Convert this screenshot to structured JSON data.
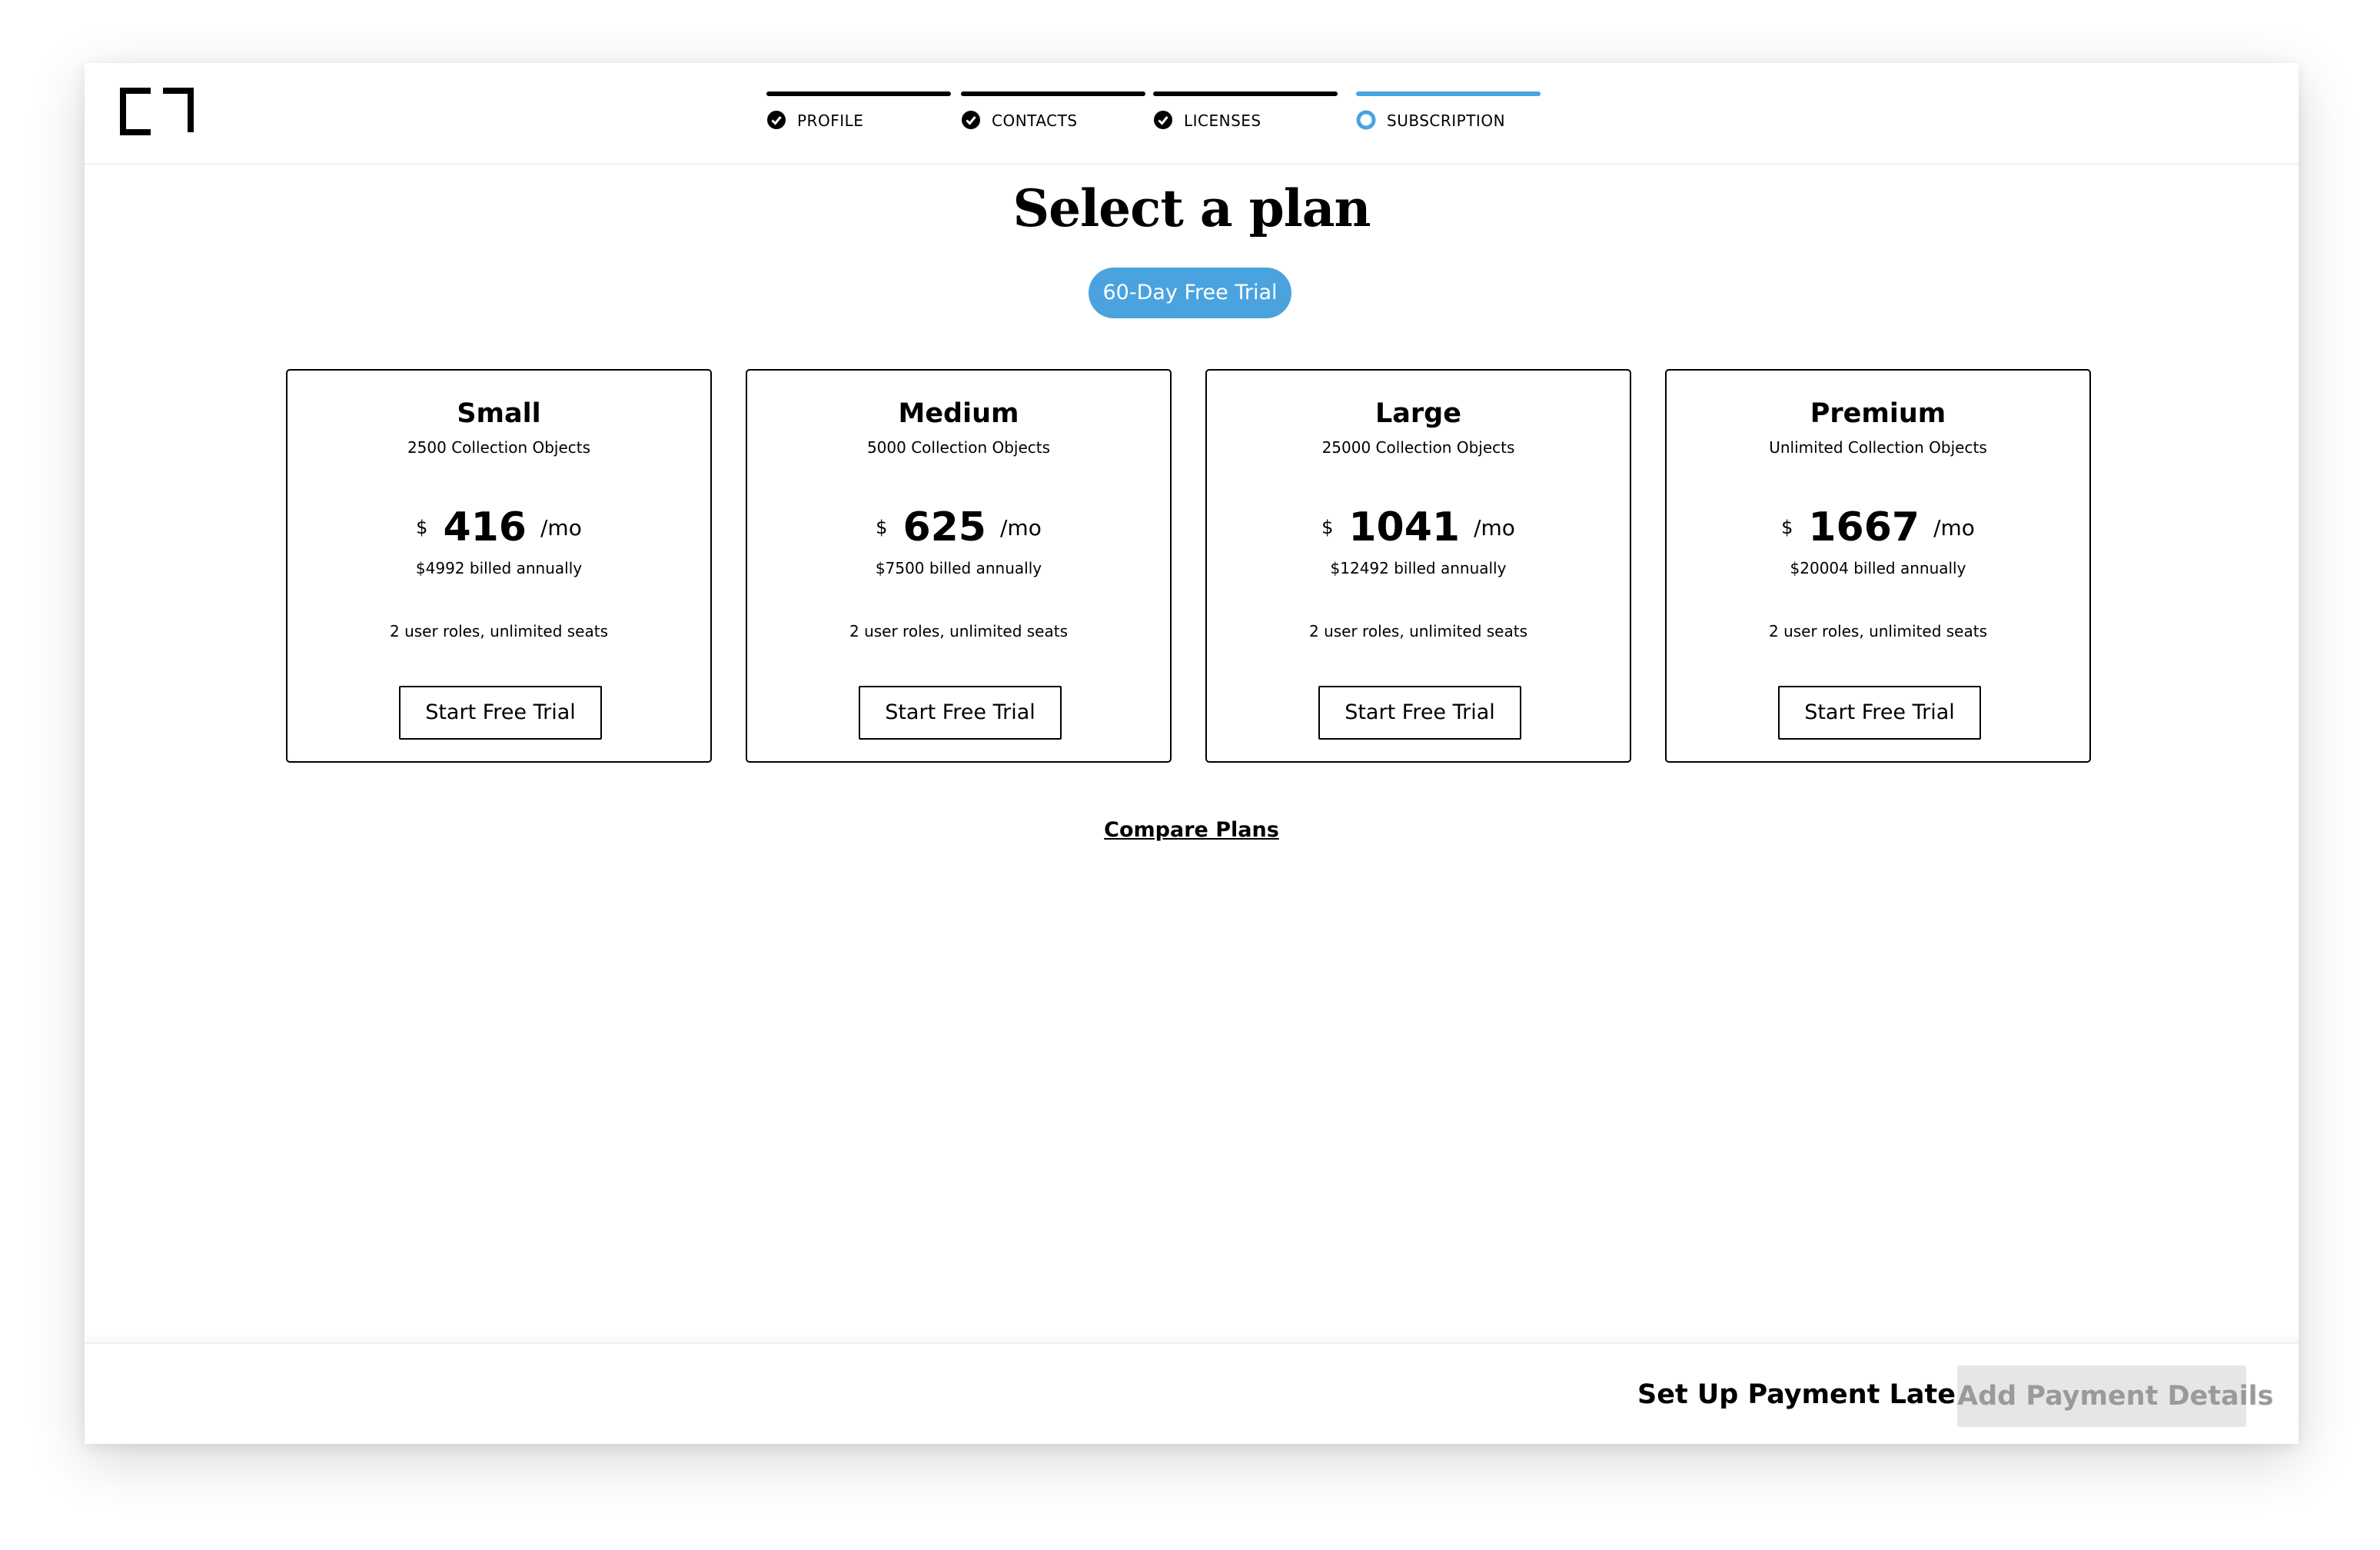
{
  "header": {
    "logo_icon": "bracket-logo",
    "steps": [
      {
        "label": "PROFILE",
        "status": "complete"
      },
      {
        "label": "CONTACTS",
        "status": "complete"
      },
      {
        "label": "LICENSES",
        "status": "complete"
      },
      {
        "label": "SUBSCRIPTION",
        "status": "current"
      }
    ]
  },
  "main": {
    "title": "Select a plan",
    "trial_badge": "60-Day Free Trial",
    "plans": [
      {
        "name": "Small",
        "objects": "2500 Collection Objects",
        "currency": "$",
        "price": "416",
        "period": "/mo",
        "annual": "$4992 billed annually",
        "seats": "2 user roles, unlimited seats",
        "button": "Start Free Trial"
      },
      {
        "name": "Medium",
        "objects": "5000 Collection Objects",
        "currency": "$",
        "price": "625",
        "period": "/mo",
        "annual": "$7500 billed annually",
        "seats": "2 user roles, unlimited seats",
        "button": "Start Free Trial"
      },
      {
        "name": "Large",
        "objects": "25000 Collection Objects",
        "currency": "$",
        "price": "1041",
        "period": "/mo",
        "annual": "$12492 billed annually",
        "seats": "2 user roles, unlimited seats",
        "button": "Start Free Trial"
      },
      {
        "name": "Premium",
        "objects": "Unlimited Collection Objects",
        "currency": "$",
        "price": "1667",
        "period": "/mo",
        "annual": "$20004 billed annually",
        "seats": "2 user roles, unlimited seats",
        "button": "Start Free Trial"
      }
    ],
    "compare_link": "Compare Plans"
  },
  "footer": {
    "pay_later": "Set Up Payment Later",
    "add_payment": "Add Payment Details"
  },
  "colors": {
    "accent": "#4aa3df",
    "disabled_bg": "#e6e6e6",
    "disabled_text": "#9a9a9a"
  }
}
